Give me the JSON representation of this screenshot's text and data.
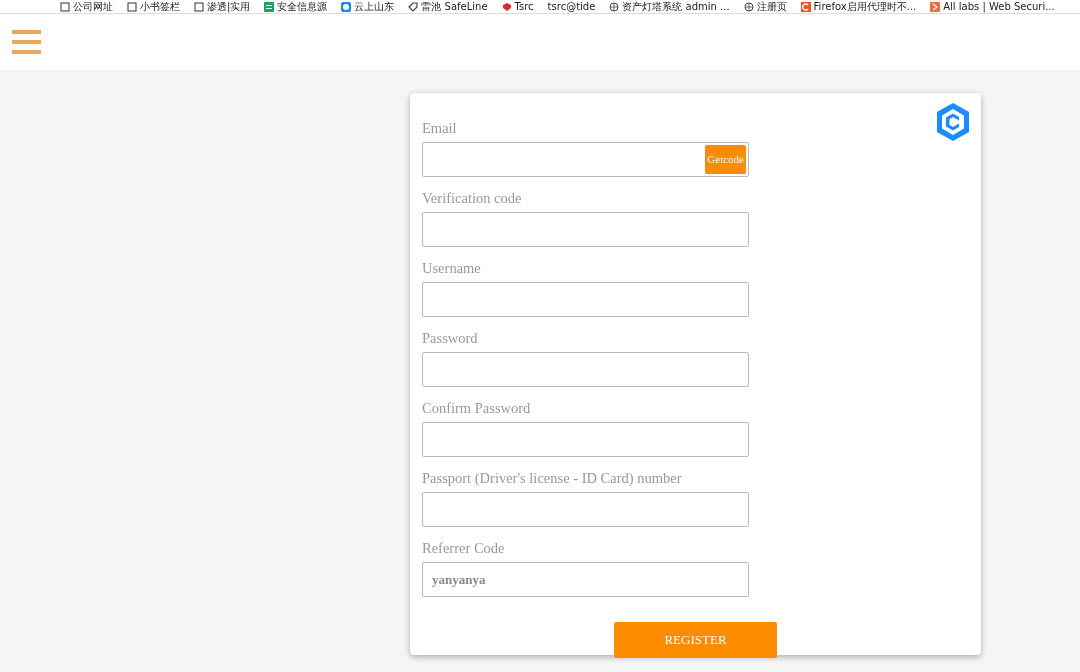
{
  "bookmarks": [
    {
      "label": "公司网址",
      "kind": "folder"
    },
    {
      "label": "小书签栏",
      "kind": "folder"
    },
    {
      "label": "渗透|实用",
      "kind": "folder"
    },
    {
      "label": "安全信息源",
      "kind": "sheet"
    },
    {
      "label": "云上山东",
      "kind": "chat"
    },
    {
      "label": "雷池 SafeLine",
      "kind": "tag"
    },
    {
      "label": "Tsrc",
      "kind": "shield"
    },
    {
      "label": "tsrc@tide",
      "kind": "plain"
    },
    {
      "label": "资产灯塔系统 admin ...",
      "kind": "globe"
    },
    {
      "label": "注册页",
      "kind": "globe"
    },
    {
      "label": "Firefox启用代理时不...",
      "kind": "letter"
    },
    {
      "label": "All labs | Web Securi...",
      "kind": "arrow"
    }
  ],
  "form": {
    "fields": [
      {
        "label": "Email",
        "button": "Getcode"
      },
      {
        "label": "Verification code"
      },
      {
        "label": "Username"
      },
      {
        "label": "Password"
      },
      {
        "label": "Confirm Password"
      },
      {
        "label": "Passport (Driver's license - ID Card) number"
      },
      {
        "label": "Referrer Code",
        "value": "yanyanya"
      }
    ],
    "submit": "REGISTER"
  }
}
